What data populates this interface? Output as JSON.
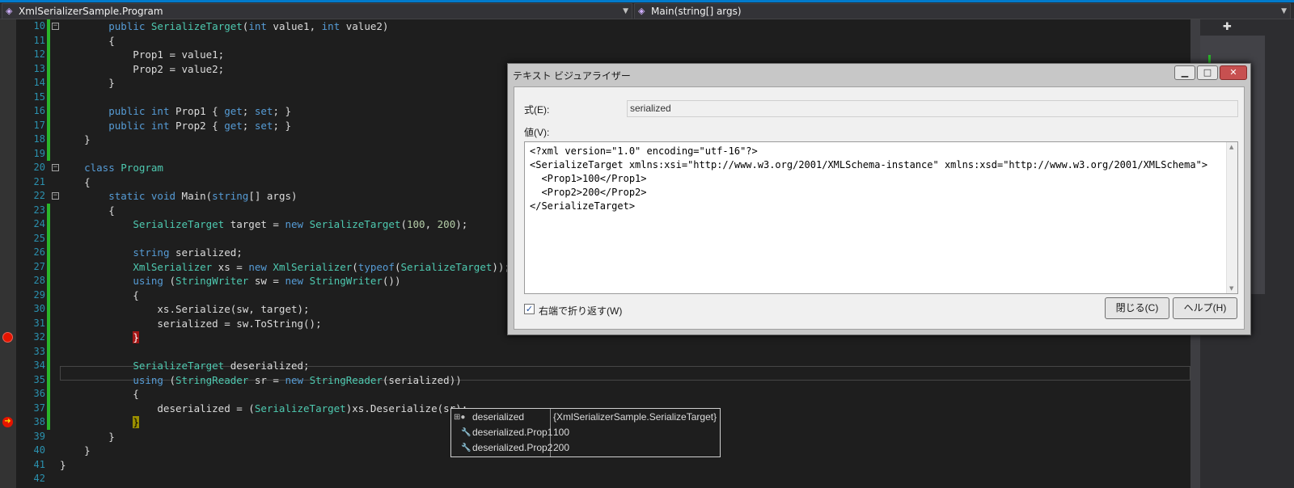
{
  "nav": {
    "type_selector": "XmlSerializerSample.Program",
    "member_selector": "Main(string[] args)"
  },
  "code_lines": [
    {
      "num": "10",
      "tokens": [
        [
          "t",
          "        "
        ],
        [
          "k",
          "public"
        ],
        [
          "t",
          " "
        ],
        [
          "ty",
          "SerializeTarget"
        ],
        [
          "t",
          "("
        ],
        [
          "k",
          "int"
        ],
        [
          "t",
          " value1, "
        ],
        [
          "k",
          "int"
        ],
        [
          "t",
          " value2)"
        ]
      ]
    },
    {
      "num": "11",
      "tokens": [
        [
          "t",
          "        {"
        ]
      ]
    },
    {
      "num": "12",
      "tokens": [
        [
          "t",
          "            Prop1 = value1;"
        ]
      ]
    },
    {
      "num": "13",
      "tokens": [
        [
          "t",
          "            Prop2 = value2;"
        ]
      ]
    },
    {
      "num": "14",
      "tokens": [
        [
          "t",
          "        }"
        ]
      ]
    },
    {
      "num": "15",
      "tokens": []
    },
    {
      "num": "16",
      "tokens": [
        [
          "t",
          "        "
        ],
        [
          "k",
          "public"
        ],
        [
          "t",
          " "
        ],
        [
          "k",
          "int"
        ],
        [
          "t",
          " Prop1 { "
        ],
        [
          "k",
          "get"
        ],
        [
          "t",
          "; "
        ],
        [
          "k",
          "set"
        ],
        [
          "t",
          "; }"
        ]
      ]
    },
    {
      "num": "17",
      "tokens": [
        [
          "t",
          "        "
        ],
        [
          "k",
          "public"
        ],
        [
          "t",
          " "
        ],
        [
          "k",
          "int"
        ],
        [
          "t",
          " Prop2 { "
        ],
        [
          "k",
          "get"
        ],
        [
          "t",
          "; "
        ],
        [
          "k",
          "set"
        ],
        [
          "t",
          "; }"
        ]
      ]
    },
    {
      "num": "18",
      "tokens": [
        [
          "t",
          "    }"
        ]
      ]
    },
    {
      "num": "19",
      "tokens": []
    },
    {
      "num": "20",
      "tokens": [
        [
          "t",
          "    "
        ],
        [
          "k",
          "class"
        ],
        [
          "t",
          " "
        ],
        [
          "ty",
          "Program"
        ]
      ]
    },
    {
      "num": "21",
      "tokens": [
        [
          "t",
          "    {"
        ]
      ]
    },
    {
      "num": "22",
      "tokens": [
        [
          "t",
          "        "
        ],
        [
          "k",
          "static"
        ],
        [
          "t",
          " "
        ],
        [
          "k",
          "void"
        ],
        [
          "t",
          " Main("
        ],
        [
          "k",
          "string"
        ],
        [
          "t",
          "[] args)"
        ]
      ]
    },
    {
      "num": "23",
      "tokens": [
        [
          "t",
          "        {"
        ]
      ]
    },
    {
      "num": "24",
      "tokens": [
        [
          "t",
          "            "
        ],
        [
          "ty",
          "SerializeTarget"
        ],
        [
          "t",
          " target = "
        ],
        [
          "k",
          "new"
        ],
        [
          "t",
          " "
        ],
        [
          "ty",
          "SerializeTarget"
        ],
        [
          "t",
          "("
        ],
        [
          "n",
          "100"
        ],
        [
          "t",
          ", "
        ],
        [
          "n",
          "200"
        ],
        [
          "t",
          ");"
        ]
      ]
    },
    {
      "num": "25",
      "tokens": []
    },
    {
      "num": "26",
      "tokens": [
        [
          "t",
          "            "
        ],
        [
          "k",
          "string"
        ],
        [
          "t",
          " serialized;"
        ]
      ]
    },
    {
      "num": "27",
      "tokens": [
        [
          "t",
          "            "
        ],
        [
          "ty",
          "XmlSerializer"
        ],
        [
          "t",
          " xs = "
        ],
        [
          "k",
          "new"
        ],
        [
          "t",
          " "
        ],
        [
          "ty",
          "XmlSerializer"
        ],
        [
          "t",
          "("
        ],
        [
          "k",
          "typeof"
        ],
        [
          "t",
          "("
        ],
        [
          "ty",
          "SerializeTarget"
        ],
        [
          "t",
          "));"
        ]
      ]
    },
    {
      "num": "28",
      "tokens": [
        [
          "t",
          "            "
        ],
        [
          "k",
          "using"
        ],
        [
          "t",
          " ("
        ],
        [
          "ty",
          "StringWriter"
        ],
        [
          "t",
          " sw = "
        ],
        [
          "k",
          "new"
        ],
        [
          "t",
          " "
        ],
        [
          "ty",
          "StringWriter"
        ],
        [
          "t",
          "())"
        ]
      ]
    },
    {
      "num": "29",
      "tokens": [
        [
          "t",
          "            {"
        ]
      ]
    },
    {
      "num": "30",
      "tokens": [
        [
          "t",
          "                xs.Serialize(sw, target);"
        ]
      ]
    },
    {
      "num": "31",
      "tokens": [
        [
          "t",
          "                serialized = sw.ToString();"
        ]
      ]
    },
    {
      "num": "32",
      "tokens": [
        [
          "t",
          "            "
        ],
        [
          "b",
          "}"
        ]
      ]
    },
    {
      "num": "33",
      "tokens": []
    },
    {
      "num": "34",
      "tokens": [
        [
          "t",
          "            "
        ],
        [
          "ty",
          "SerializeTarget"
        ],
        [
          "t",
          " deserialized;"
        ]
      ]
    },
    {
      "num": "35",
      "tokens": [
        [
          "t",
          "            "
        ],
        [
          "k",
          "using"
        ],
        [
          "t",
          " ("
        ],
        [
          "ty",
          "StringReader"
        ],
        [
          "t",
          " sr = "
        ],
        [
          "k",
          "new"
        ],
        [
          "t",
          " "
        ],
        [
          "ty",
          "StringReader"
        ],
        [
          "t",
          "(serialized))"
        ]
      ]
    },
    {
      "num": "36",
      "tokens": [
        [
          "t",
          "            {"
        ]
      ]
    },
    {
      "num": "37",
      "tokens": [
        [
          "t",
          "                deserialized = ("
        ],
        [
          "ty",
          "SerializeTarget"
        ],
        [
          "t",
          ")xs.Deserialize(sr);"
        ]
      ]
    },
    {
      "num": "38",
      "tokens": [
        [
          "t",
          "            "
        ],
        [
          "y",
          "}"
        ]
      ]
    },
    {
      "num": "39",
      "tokens": [
        [
          "t",
          "        }"
        ]
      ]
    },
    {
      "num": "40",
      "tokens": [
        [
          "t",
          "    }"
        ]
      ]
    },
    {
      "num": "41",
      "tokens": [
        [
          "t",
          "}"
        ]
      ]
    },
    {
      "num": "42",
      "tokens": []
    }
  ],
  "datatip": {
    "rows": [
      {
        "name": "deserialized",
        "value": "{XmlSerializerSample.SerializeTarget}",
        "icon": "expand-object-icon"
      },
      {
        "name": "deserialized.Prop1",
        "value": "100",
        "icon": "wrench-property-icon"
      },
      {
        "name": "deserialized.Prop2",
        "value": "200",
        "icon": "wrench-property-icon"
      }
    ]
  },
  "dialog": {
    "title": "テキスト ビジュアライザー",
    "expr_label": "式(E):",
    "expr_value": "serialized",
    "value_label": "値(V):",
    "value_text": "<?xml version=\"1.0\" encoding=\"utf-16\"?>\n<SerializeTarget xmlns:xsi=\"http://www.w3.org/2001/XMLSchema-instance\" xmlns:xsd=\"http://www.w3.org/2001/XMLSchema\">\n  <Prop1>100</Prop1>\n  <Prop2>200</Prop2>\n</SerializeTarget>",
    "wrap_label": "右端で折り返す(W)",
    "wrap_checked": "✓",
    "close_button": "閉じる(C)",
    "help_button": "ヘルプ(H)",
    "minimize_glyph": "▁",
    "maximize_glyph": "□",
    "close_glyph": "✕"
  },
  "colors": {
    "keyword": "#569cd6",
    "type": "#4ec9b0",
    "line_number": "#2b91af",
    "breakpoint": "#e51400",
    "change_bar": "#2ab52a"
  }
}
